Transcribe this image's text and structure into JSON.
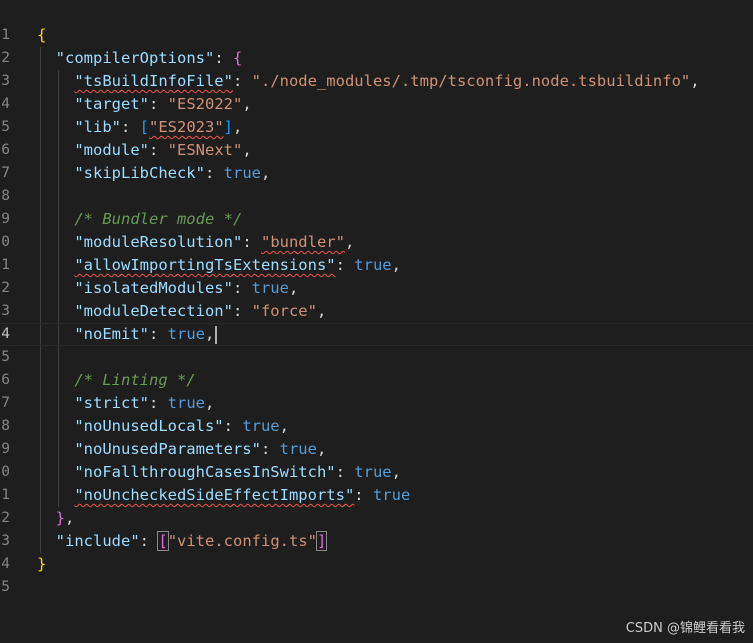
{
  "editor": {
    "active_line": 14,
    "line_numbers": [
      "1",
      "2",
      "3",
      "4",
      "5",
      "6",
      "7",
      "8",
      "9",
      "0",
      "1",
      "2",
      "3",
      "4",
      "5",
      "6",
      "7",
      "8",
      "9",
      "0",
      "1",
      "2",
      "3",
      "4",
      "5"
    ],
    "lines": [
      [
        {
          "t": "{",
          "c": "br1"
        }
      ],
      [
        {
          "t": "  "
        },
        {
          "t": "\"compilerOptions\"",
          "c": "k"
        },
        {
          "t": ": "
        },
        {
          "t": "{",
          "c": "br2"
        }
      ],
      [
        {
          "t": "    "
        },
        {
          "t": "\"tsBuildInfoFile\"",
          "c": "k",
          "e": true
        },
        {
          "t": ": "
        },
        {
          "t": "\"./node_modules/.tmp/tsconfig.node.tsbuildinfo\"",
          "c": "s"
        },
        {
          "t": ","
        }
      ],
      [
        {
          "t": "    "
        },
        {
          "t": "\"target\"",
          "c": "k"
        },
        {
          "t": ": "
        },
        {
          "t": "\"ES2022\"",
          "c": "s"
        },
        {
          "t": ","
        }
      ],
      [
        {
          "t": "    "
        },
        {
          "t": "\"lib\"",
          "c": "k"
        },
        {
          "t": ": "
        },
        {
          "t": "[",
          "c": "br3"
        },
        {
          "t": "\"ES2023\"",
          "c": "s",
          "e": true
        },
        {
          "t": "]",
          "c": "br3"
        },
        {
          "t": ","
        }
      ],
      [
        {
          "t": "    "
        },
        {
          "t": "\"module\"",
          "c": "k"
        },
        {
          "t": ": "
        },
        {
          "t": "\"ESNext\"",
          "c": "s"
        },
        {
          "t": ","
        }
      ],
      [
        {
          "t": "    "
        },
        {
          "t": "\"skipLibCheck\"",
          "c": "k"
        },
        {
          "t": ": "
        },
        {
          "t": "true",
          "c": "b"
        },
        {
          "t": ","
        }
      ],
      [],
      [
        {
          "t": "    "
        },
        {
          "t": "/* Bundler mode */",
          "c": "c"
        }
      ],
      [
        {
          "t": "    "
        },
        {
          "t": "\"moduleResolution\"",
          "c": "k"
        },
        {
          "t": ": "
        },
        {
          "t": "\"bundler\"",
          "c": "s",
          "e": true
        },
        {
          "t": ","
        }
      ],
      [
        {
          "t": "    "
        },
        {
          "t": "\"allowImportingTsExtensions\"",
          "c": "k",
          "e": true
        },
        {
          "t": ": "
        },
        {
          "t": "true",
          "c": "b"
        },
        {
          "t": ","
        }
      ],
      [
        {
          "t": "    "
        },
        {
          "t": "\"isolatedModules\"",
          "c": "k"
        },
        {
          "t": ": "
        },
        {
          "t": "true",
          "c": "b"
        },
        {
          "t": ","
        }
      ],
      [
        {
          "t": "    "
        },
        {
          "t": "\"moduleDetection\"",
          "c": "k"
        },
        {
          "t": ": "
        },
        {
          "t": "\"force\"",
          "c": "s"
        },
        {
          "t": ","
        }
      ],
      [
        {
          "t": "    "
        },
        {
          "t": "\"noEmit\"",
          "c": "k"
        },
        {
          "t": ": "
        },
        {
          "t": "true",
          "c": "b"
        },
        {
          "t": ","
        },
        {
          "cursor": true
        }
      ],
      [],
      [
        {
          "t": "    "
        },
        {
          "t": "/* Linting */",
          "c": "c"
        }
      ],
      [
        {
          "t": "    "
        },
        {
          "t": "\"strict\"",
          "c": "k"
        },
        {
          "t": ": "
        },
        {
          "t": "true",
          "c": "b"
        },
        {
          "t": ","
        }
      ],
      [
        {
          "t": "    "
        },
        {
          "t": "\"noUnusedLocals\"",
          "c": "k"
        },
        {
          "t": ": "
        },
        {
          "t": "true",
          "c": "b"
        },
        {
          "t": ","
        }
      ],
      [
        {
          "t": "    "
        },
        {
          "t": "\"noUnusedParameters\"",
          "c": "k"
        },
        {
          "t": ": "
        },
        {
          "t": "true",
          "c": "b"
        },
        {
          "t": ","
        }
      ],
      [
        {
          "t": "    "
        },
        {
          "t": "\"noFallthroughCasesInSwitch\"",
          "c": "k"
        },
        {
          "t": ": "
        },
        {
          "t": "true",
          "c": "b"
        },
        {
          "t": ","
        }
      ],
      [
        {
          "t": "    "
        },
        {
          "t": "\"noUncheckedSideEffectImports\"",
          "c": "k",
          "e": true
        },
        {
          "t": ": "
        },
        {
          "t": "true",
          "c": "b"
        }
      ],
      [
        {
          "t": "  "
        },
        {
          "t": "}",
          "c": "br2"
        },
        {
          "t": ","
        }
      ],
      [
        {
          "t": "  "
        },
        {
          "t": "\"include\"",
          "c": "k"
        },
        {
          "t": ": "
        },
        {
          "t": "[",
          "c": "br2",
          "m": true
        },
        {
          "t": "\"vite.config.ts\"",
          "c": "s"
        },
        {
          "t": "]",
          "c": "br2",
          "m": true
        }
      ],
      [
        {
          "t": "}",
          "c": "br1"
        }
      ],
      []
    ]
  },
  "colors": {
    "background": "#1e1e1e",
    "key": "#9cdcfe",
    "string": "#ce9178",
    "boolean": "#569cd6",
    "comment": "#6a9955",
    "error_squiggle": "#f14c4c"
  },
  "watermark": "CSDN @锦鲤看看我"
}
